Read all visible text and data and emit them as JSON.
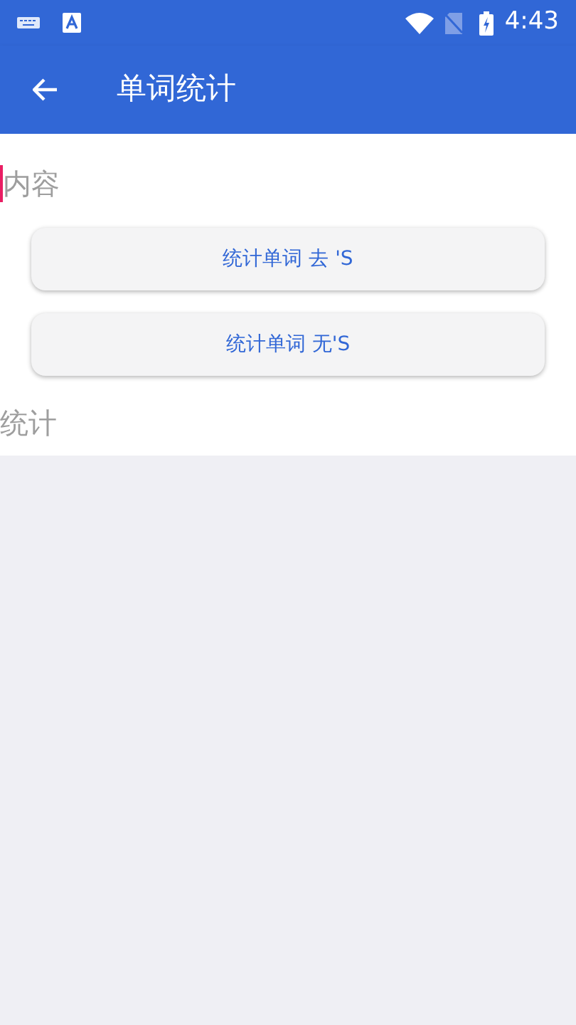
{
  "status_bar": {
    "time": "4:43"
  },
  "app_bar": {
    "title": "单词统计"
  },
  "content_field": {
    "placeholder": "内容",
    "focused": true
  },
  "buttons": [
    {
      "label": "统计单词 去 'S"
    },
    {
      "label": "统计单词 无'S"
    }
  ],
  "result_field": {
    "placeholder": "统计"
  }
}
